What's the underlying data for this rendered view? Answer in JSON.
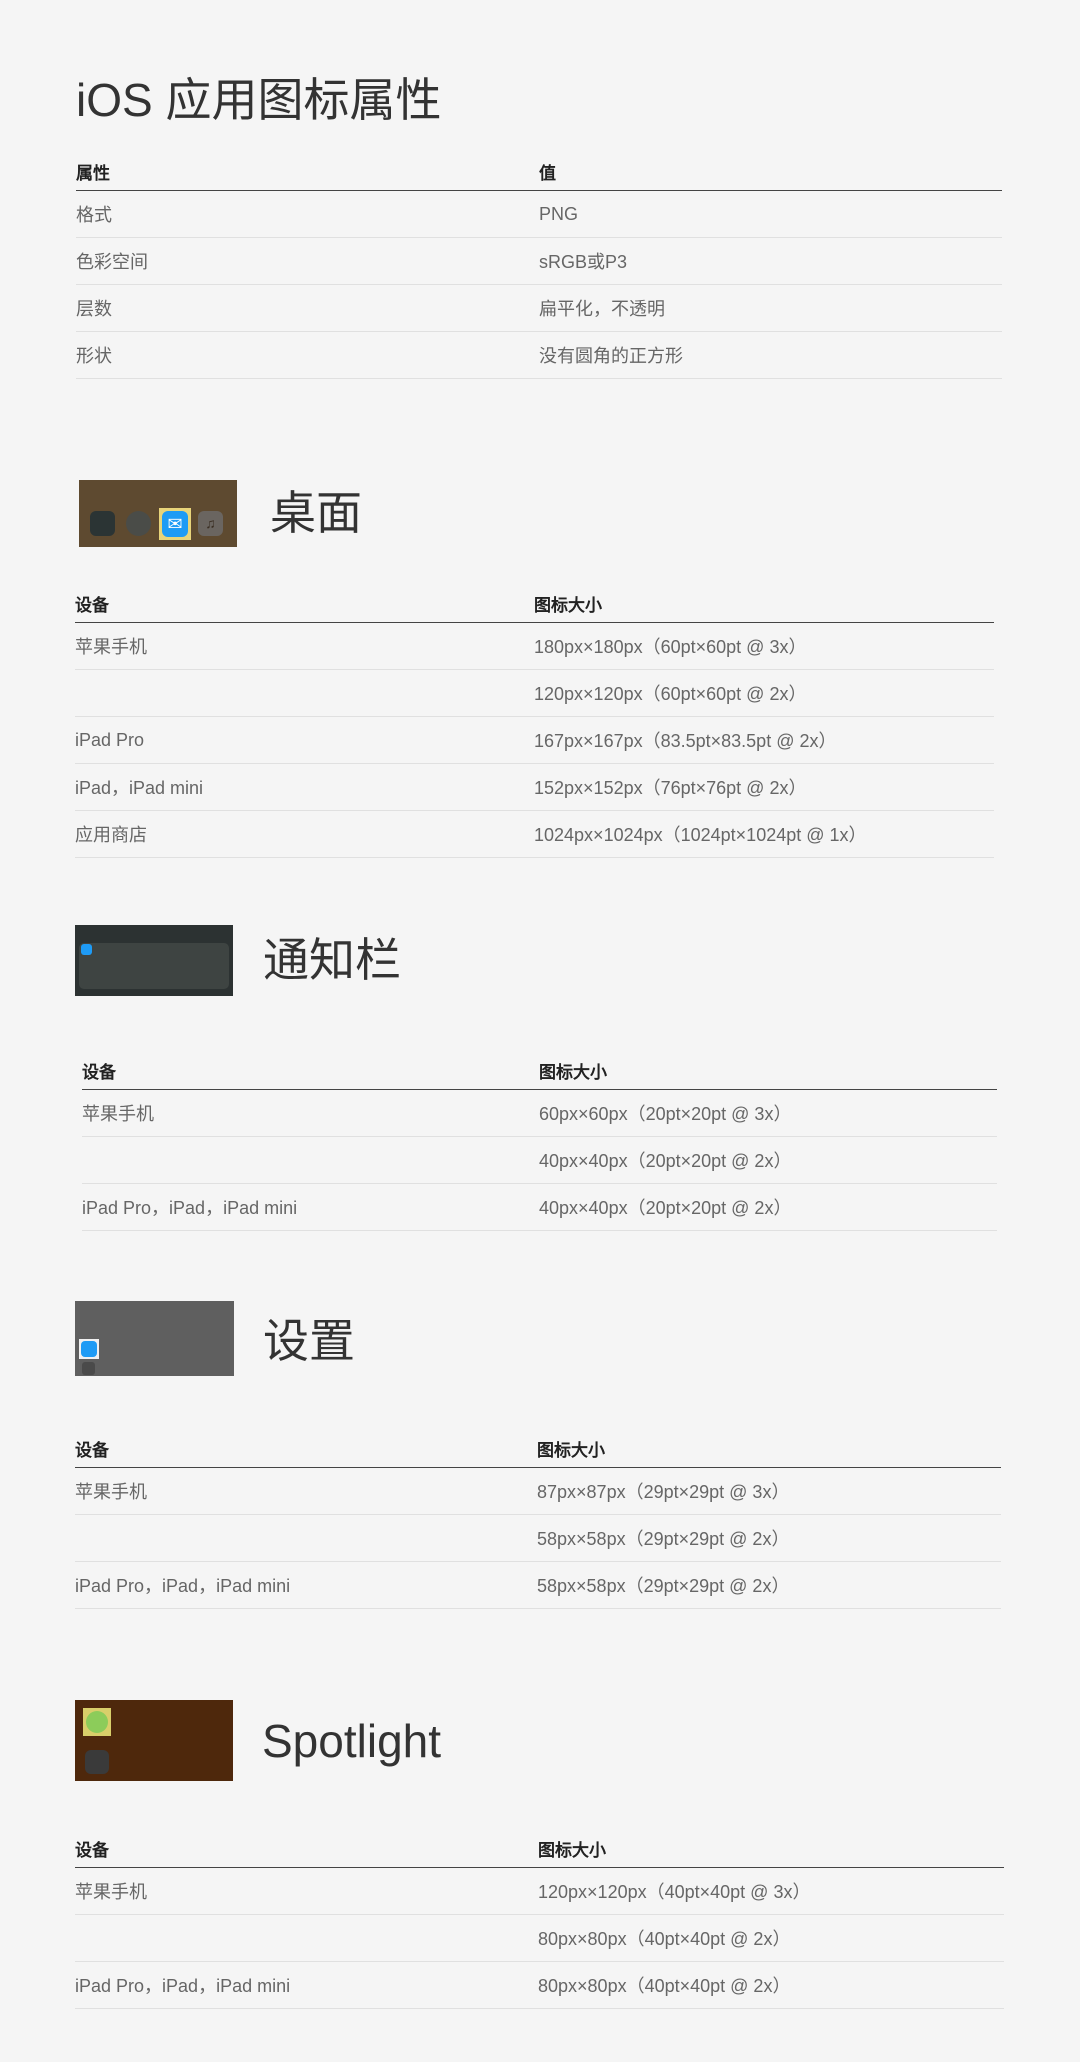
{
  "page_title": "iOS 应用图标属性",
  "properties_table": {
    "headers": [
      "属性",
      "值"
    ],
    "rows": [
      [
        "格式",
        "PNG"
      ],
      [
        "色彩空间",
        "sRGB或P3"
      ],
      [
        "层数",
        "扁平化，不透明"
      ],
      [
        "形状",
        "没有圆角的正方形"
      ]
    ]
  },
  "sections": [
    {
      "title": "桌面",
      "thumbnail_icon": "home-screen-dock-thumbnail",
      "headers": [
        "设备",
        "图标大小"
      ],
      "rows": [
        [
          "苹果手机",
          "180px×180px（60pt×60pt @ 3x）"
        ],
        [
          "",
          "120px×120px（60pt×60pt @ 2x）"
        ],
        [
          "iPad Pro",
          "167px×167px（83.5pt×83.5pt @ 2x）"
        ],
        [
          "iPad，iPad mini",
          "152px×152px（76pt×76pt @ 2x）"
        ],
        [
          "应用商店",
          "1024px×1024px（1024pt×1024pt @ 1x）"
        ]
      ]
    },
    {
      "title": "通知栏",
      "thumbnail_icon": "notification-thumbnail",
      "headers": [
        "设备",
        "图标大小"
      ],
      "rows": [
        [
          "苹果手机",
          "60px×60px（20pt×20pt @ 3x）"
        ],
        [
          "",
          "40px×40px（20pt×20pt @ 2x）"
        ],
        [
          "iPad Pro，iPad，iPad mini",
          "40px×40px（20pt×20pt @ 2x）"
        ]
      ]
    },
    {
      "title": "设置",
      "thumbnail_icon": "settings-thumbnail",
      "headers": [
        "设备",
        "图标大小"
      ],
      "rows": [
        [
          "苹果手机",
          "87px×87px（29pt×29pt @ 3x）"
        ],
        [
          "",
          "58px×58px（29pt×29pt @ 2x）"
        ],
        [
          "iPad Pro，iPad，iPad mini",
          "58px×58px（29pt×29pt @ 2x）"
        ]
      ]
    },
    {
      "title": "Spotlight",
      "thumbnail_icon": "spotlight-thumbnail",
      "headers": [
        "设备",
        "图标大小"
      ],
      "rows": [
        [
          "苹果手机",
          "120px×120px（40pt×40pt @ 3x）"
        ],
        [
          "",
          "80px×80px（40pt×40pt @ 2x）"
        ],
        [
          "iPad Pro，iPad，iPad mini",
          "80px×80px（40pt×40pt @ 2x）"
        ]
      ]
    }
  ],
  "colors": {
    "background": "#f5f5f5",
    "text": "#333333",
    "muted": "#666666",
    "mail_blue": "#1e9bf5"
  }
}
